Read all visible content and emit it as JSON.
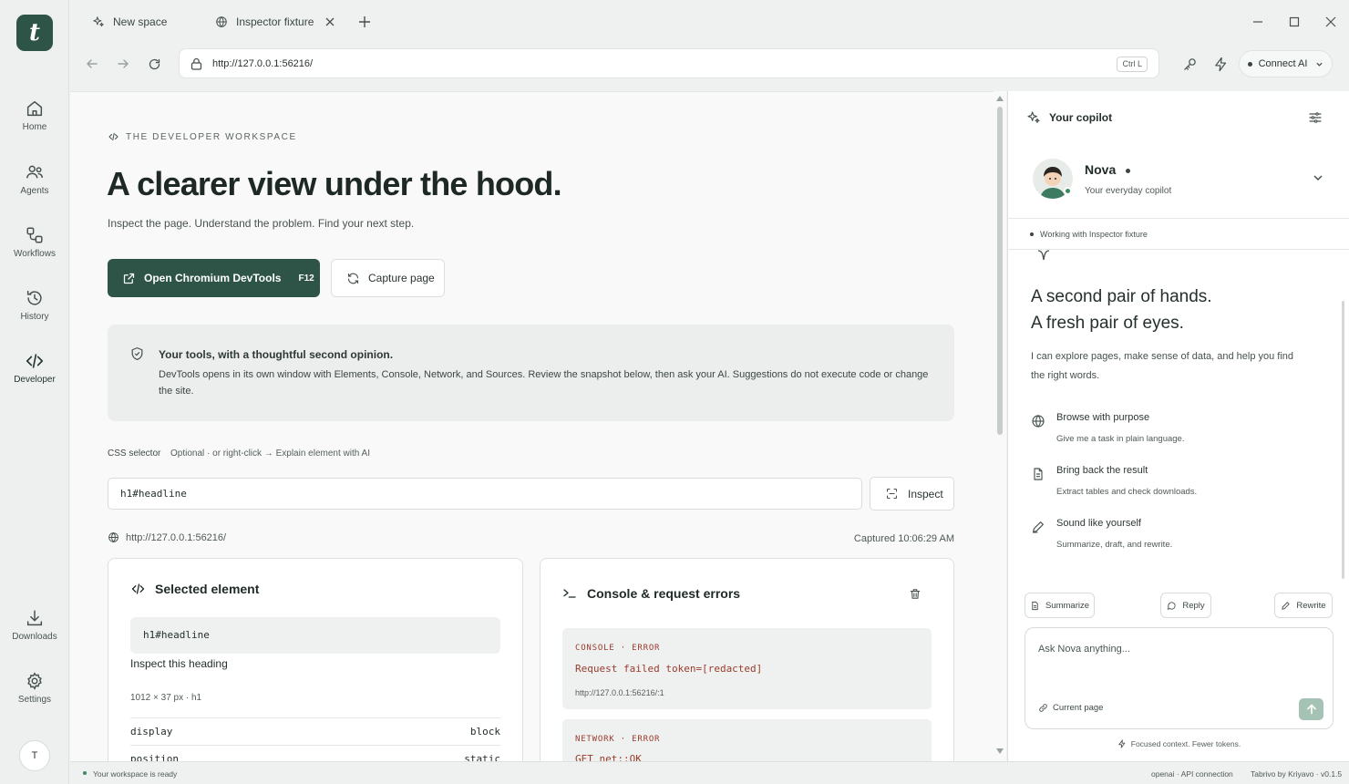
{
  "app": {
    "logo_letter": "t",
    "brand_color": "#2d5446",
    "rail": [
      {
        "label": "Home",
        "icon": "home-icon"
      },
      {
        "label": "Agents",
        "icon": "agents-icon"
      },
      {
        "label": "Workflows",
        "icon": "workflows-icon"
      },
      {
        "label": "History",
        "icon": "history-icon"
      },
      {
        "label": "Developer",
        "icon": "code-icon",
        "active": true
      }
    ],
    "rail_bottom": [
      {
        "label": "Downloads",
        "icon": "download-icon"
      },
      {
        "label": "Settings",
        "icon": "gear-icon"
      }
    ],
    "user_initial": "T"
  },
  "tabs": [
    {
      "label": "New space",
      "icon": "sparkle-icon"
    },
    {
      "label": "Inspector fixture",
      "icon": "globe-icon",
      "active": true
    }
  ],
  "addressbar": {
    "url": "http://127.0.0.1:56216/",
    "shortcut": "Ctrl L"
  },
  "toolbar": {
    "connect_label": "Connect AI"
  },
  "page": {
    "eyebrow": "THE DEVELOPER WORKSPACE",
    "headline": "A clearer view under the hood.",
    "subline": "Inspect the page. Understand the problem. Find your next step.",
    "open_devtools_label": "Open Chromium DevTools",
    "open_devtools_key": "F12",
    "capture_label": "Capture page",
    "note_title": "Your tools, with a thoughtful second opinion.",
    "note_text": "DevTools opens in its own window with Elements, Console, Network, and Sources. Review the snapshot below, then ask your AI. Suggestions do not execute code or change the site.",
    "selector_label": "CSS selector",
    "selector_hint": "Optional · or right-click → Explain element with AI",
    "selector_value": "h1#headline",
    "inspect_label": "Inspect",
    "snapshot_url": "http://127.0.0.1:56216/",
    "captured": "Captured 10:06:29 AM",
    "selected": {
      "title": "Selected element",
      "selector": "h1#headline",
      "text": "Inspect this heading",
      "dims": "1012 × 37 px · h1",
      "props": [
        {
          "name": "display",
          "value": "block"
        },
        {
          "name": "position",
          "value": "static"
        }
      ]
    },
    "console": {
      "title": "Console & request errors",
      "errors": [
        {
          "kind": "CONSOLE · ERROR",
          "message": "Request failed token=[redacted]",
          "location": "http://127.0.0.1:56216/:1"
        },
        {
          "kind": "NETWORK · ERROR",
          "message": "GET net::OK",
          "location": ""
        }
      ]
    }
  },
  "copilot": {
    "header": "Your copilot",
    "persona_name": "Nova",
    "persona_role": "Your everyday copilot",
    "context": "Working with Inspector fixture",
    "hero_line1": "A second pair of hands.",
    "hero_line2": "A fresh pair of eyes.",
    "hero_desc": "I can explore pages, make sense of data, and help you find the right words.",
    "features": [
      {
        "title": "Browse with purpose",
        "desc": "Give me a task in plain language.",
        "icon": "globe-icon"
      },
      {
        "title": "Bring back the result",
        "desc": "Extract tables and check downloads.",
        "icon": "document-icon"
      },
      {
        "title": "Sound like yourself",
        "desc": "Summarize, draft, and rewrite.",
        "icon": "pen-icon"
      }
    ],
    "chips": [
      "Summarize",
      "Reply",
      "Rewrite"
    ],
    "composer_placeholder": "Ask Nova anything...",
    "composer_context": "Current page",
    "footer": "Focused context. Fewer tokens."
  },
  "status": {
    "left": "Your workspace is ready",
    "api": "openai · API connection",
    "version": "Tabrivo by Kriyavo · v0.1.5"
  }
}
